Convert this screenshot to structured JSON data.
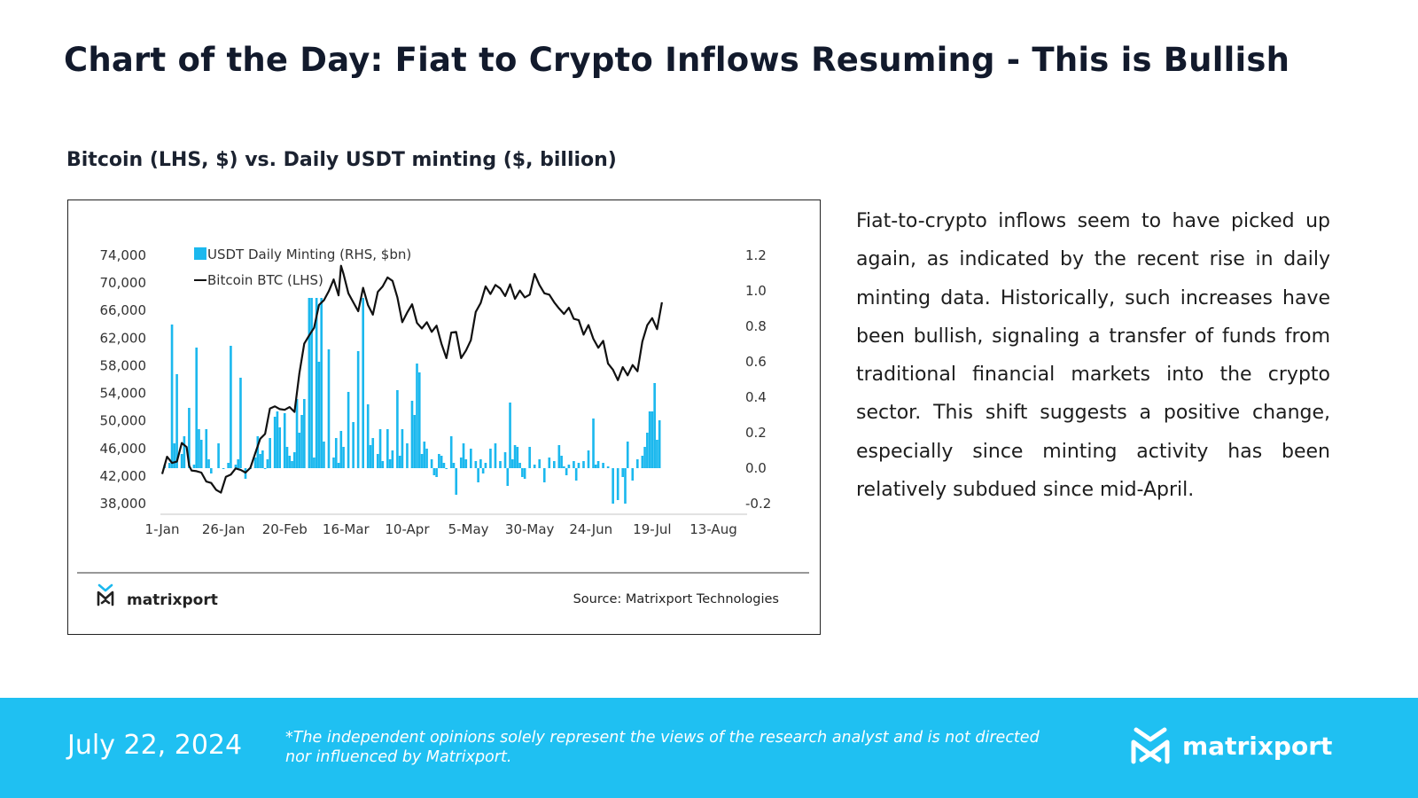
{
  "header": {
    "title": "Chart of the Day: Fiat to Crypto Inflows Resuming - This is Bullish",
    "chart_subtitle": "Bitcoin (LHS, $) vs. Daily USDT minting ($, billion)"
  },
  "body": {
    "paragraph": "Fiat-to-crypto inflows seem to have picked up again, as indicated by the recent rise in daily minting data. Historically, such increases have been bullish, signaling a transfer of funds from traditional financial markets into the crypto sector. This shift suggests a positive change, especially since minting activity has been relatively subdued since mid-April."
  },
  "chart_footer": {
    "logo_text": "matrixport",
    "source": "Source: Matrixport Technologies"
  },
  "footer": {
    "date": "July 22, 2024",
    "disclaimer": "*The independent opinions solely represent the views of the research analyst and is not directed nor influenced by Matrixport.",
    "logo_text": "matrixport"
  },
  "colors": {
    "bar": "#1bb8ee",
    "line": "#111111",
    "footer_bg": "#1fc0f2",
    "title": "#121a2c"
  },
  "chart_data": {
    "type": "bar+line",
    "title": "Bitcoin (LHS, $) vs. Daily USDT minting ($, billion)",
    "xlabel": "",
    "ylabel_left": "Bitcoin BTC (LHS)",
    "ylabel_right": "USDT Daily Minting (RHS, $bn)",
    "legend": [
      "USDT Daily Minting (RHS, $bn)",
      "Bitcoin BTC (LHS)"
    ],
    "legend_position": "top-left",
    "grid": false,
    "x_tick_labels": [
      "1-Jan",
      "26-Jan",
      "20-Feb",
      "16-Mar",
      "10-Apr",
      "5-May",
      "30-May",
      "24-Jun",
      "19-Jul",
      "13-Aug"
    ],
    "x_range_days": [
      0,
      225
    ],
    "y_left_ticks": [
      "74,000",
      "70,000",
      "66,000",
      "62,000",
      "58,000",
      "54,000",
      "50,000",
      "46,000",
      "42,000",
      "38,000"
    ],
    "y_left_range": [
      38000,
      74000
    ],
    "y_right_ticks": [
      "1.2",
      "1.0",
      "0.8",
      "0.6",
      "0.4",
      "0.2",
      "0.0",
      "-0.2"
    ],
    "y_right_range": [
      -0.2,
      1.2
    ],
    "series": [
      {
        "name": "Bitcoin BTC (LHS)",
        "type": "line",
        "axis": "left",
        "day": [
          0,
          2,
          4,
          6,
          8,
          10,
          11,
          12,
          14,
          16,
          18,
          20,
          22,
          24,
          26,
          28,
          30,
          32,
          34,
          36,
          38,
          40,
          42,
          44,
          46,
          48,
          50,
          52,
          54,
          56,
          58,
          60,
          62,
          64,
          66,
          68,
          70,
          72,
          73,
          74,
          76,
          78,
          80,
          82,
          84,
          86,
          88,
          90,
          92,
          94,
          96,
          98,
          100,
          102,
          104,
          106,
          108,
          110,
          112,
          114,
          116,
          118,
          120,
          122,
          124,
          126,
          128,
          130,
          132,
          134,
          136,
          138,
          140,
          142,
          144,
          146,
          148,
          150,
          152,
          154,
          156,
          158,
          160,
          162,
          164,
          166,
          168,
          170,
          172,
          174,
          176,
          178,
          180,
          182,
          184,
          186,
          188,
          190,
          192,
          194,
          196,
          198,
          200,
          202,
          204
        ],
        "values": [
          42300,
          44800,
          43900,
          44100,
          46800,
          46200,
          43500,
          42800,
          42700,
          42500,
          41200,
          41000,
          40000,
          39600,
          41900,
          42200,
          43100,
          42900,
          42500,
          43200,
          45300,
          47400,
          48100,
          51800,
          52100,
          51700,
          51600,
          52000,
          51300,
          56900,
          61200,
          62400,
          63500,
          66800,
          67500,
          68800,
          70500,
          68200,
          72500,
          71300,
          68500,
          67200,
          65900,
          69300,
          66800,
          65400,
          68700,
          69500,
          70800,
          70300,
          67900,
          64300,
          65700,
          66900,
          64200,
          63400,
          64300,
          62900,
          63800,
          61200,
          59100,
          62800,
          62900,
          59100,
          60200,
          61700,
          65800,
          67100,
          69500,
          68400,
          69700,
          69200,
          68100,
          69800,
          67700,
          68900,
          67900,
          68300,
          71300,
          69700,
          68500,
          68300,
          67200,
          66300,
          65500,
          66400,
          64800,
          64600,
          62500,
          63900,
          61900,
          60600,
          61600,
          58300,
          57400,
          55900,
          57800,
          56600,
          58100,
          57200,
          61500,
          63900,
          64900,
          63300,
          67200,
          67600
        ]
      },
      {
        "name": "USDT Daily Minting (RHS, $bn)",
        "type": "bar",
        "axis": "right",
        "day": [
          1,
          3,
          4,
          5,
          6,
          8,
          9,
          11,
          13,
          14,
          15,
          16,
          18,
          19,
          20,
          23,
          25,
          27,
          28,
          30,
          31,
          32,
          34,
          36,
          38,
          39,
          40,
          41,
          42,
          43,
          44,
          46,
          47,
          48,
          50,
          51,
          52,
          53,
          54,
          55,
          56,
          57,
          58,
          60,
          61,
          62,
          63,
          64,
          65,
          66,
          68,
          70,
          71,
          72,
          73,
          74,
          76,
          78,
          80,
          82,
          84,
          85,
          86,
          88,
          89,
          90,
          92,
          93,
          94,
          96,
          97,
          98,
          100,
          102,
          103,
          104,
          105,
          106,
          107,
          108,
          110,
          111,
          112,
          113,
          114,
          115,
          116,
          118,
          119,
          120,
          122,
          123,
          124,
          126,
          128,
          129,
          130,
          131,
          132,
          134,
          136,
          138,
          140,
          141,
          142,
          143,
          144,
          145,
          146,
          147,
          148,
          150,
          152,
          154,
          156,
          158,
          160,
          162,
          163,
          164,
          165,
          166,
          168,
          169,
          170,
          172,
          174,
          176,
          177,
          178,
          180,
          182,
          184,
          186,
          188,
          189,
          190,
          192,
          194,
          196,
          197,
          198,
          199,
          200,
          201,
          202,
          203,
          204
        ],
        "values": [
          0.02,
          0.03,
          0.81,
          0.14,
          0.53,
          0.08,
          0.18,
          0.34,
          0.02,
          0.68,
          0.22,
          0.16,
          0.22,
          0.05,
          -0.03,
          0.14,
          0.0,
          0.03,
          0.69,
          0.02,
          0.05,
          0.51,
          -0.06,
          0.0,
          0.06,
          0.18,
          0.08,
          0.1,
          0.0,
          0.05,
          0.17,
          0.29,
          0.32,
          0.23,
          0.31,
          0.12,
          0.07,
          0.04,
          0.09,
          0.39,
          0.2,
          0.3,
          0.39,
          0.96,
          0.96,
          0.06,
          0.96,
          0.6,
          0.96,
          0.15,
          0.67,
          0.06,
          0.17,
          0.03,
          0.21,
          0.12,
          0.43,
          0.26,
          0.66,
          0.96,
          0.36,
          0.13,
          0.17,
          0.08,
          0.22,
          0.04,
          0.22,
          0.05,
          0.1,
          0.44,
          0.07,
          0.22,
          0.14,
          0.38,
          0.3,
          0.59,
          0.54,
          0.08,
          0.15,
          0.11,
          0.05,
          -0.04,
          -0.05,
          0.08,
          0.07,
          0.03,
          0.0,
          0.18,
          0.03,
          -0.15,
          0.06,
          0.14,
          0.05,
          0.11,
          0.04,
          -0.08,
          0.05,
          -0.03,
          0.03,
          0.11,
          0.14,
          0.04,
          0.09,
          -0.1,
          0.37,
          0.05,
          0.13,
          0.12,
          0.03,
          -0.05,
          -0.06,
          0.12,
          0.02,
          0.05,
          -0.08,
          0.06,
          0.04,
          0.13,
          0.07,
          0.01,
          -0.04,
          0.02,
          0.04,
          -0.07,
          0.03,
          0.04,
          0.1,
          0.28,
          0.02,
          0.04,
          0.03,
          0.01,
          -0.2,
          -0.18,
          -0.05,
          -0.2,
          0.15,
          -0.07,
          0.05,
          0.07,
          0.12,
          0.2,
          0.32,
          0.32,
          0.48,
          0.16,
          0.27
        ]
      }
    ]
  }
}
